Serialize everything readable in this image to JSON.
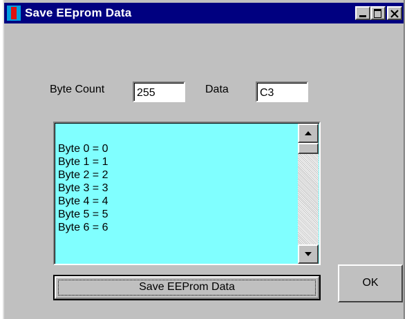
{
  "window": {
    "title": "Save EEprom Data",
    "controls": {
      "minimize": "minimize-icon",
      "maximize": "maximize-icon",
      "close": "close-icon"
    }
  },
  "form": {
    "byte_count_label": "Byte Count",
    "byte_count_value": "255",
    "data_label": "Data",
    "data_value": "C3"
  },
  "listbox": {
    "items": [
      "Byte 0 = 0",
      "Byte 1 = 1",
      "Byte 2 = 2",
      "Byte 3 = 3",
      "Byte 4 = 4",
      "Byte 5 = 5",
      "Byte 6 = 6"
    ],
    "background": "#80ffff"
  },
  "buttons": {
    "save_label": "Save EEProm Data",
    "ok_label": "OK"
  },
  "colors": {
    "titlebar": "#000080",
    "window_face": "#c0c0c0"
  }
}
